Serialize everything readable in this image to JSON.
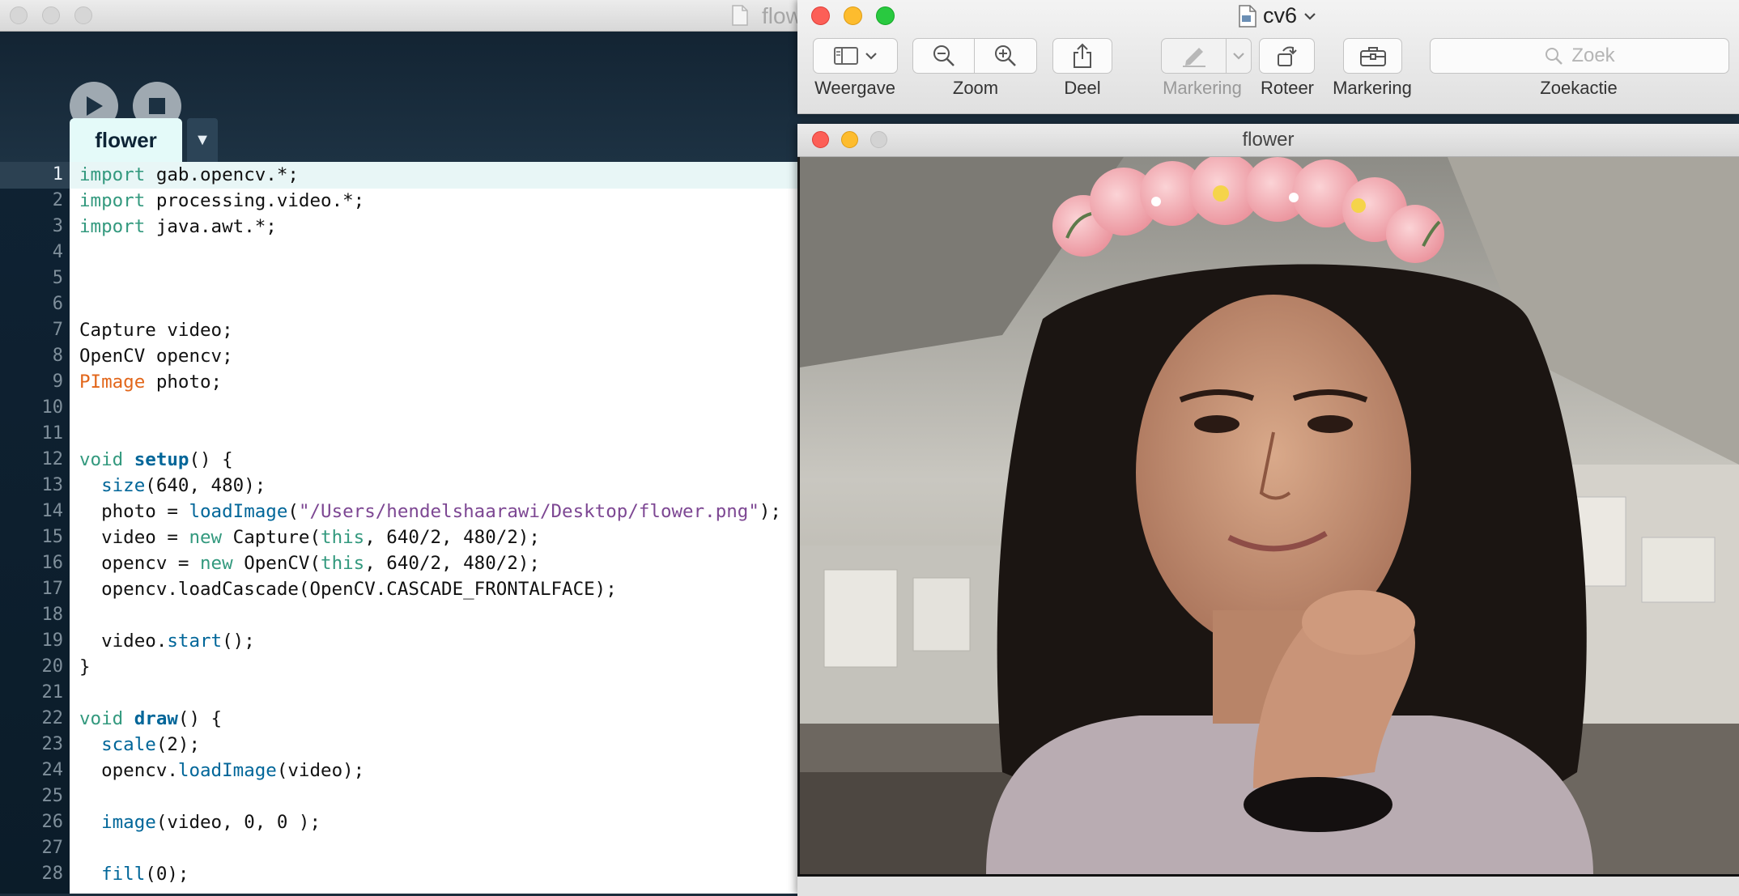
{
  "ide": {
    "window_title": "flow",
    "tab_label": "flower",
    "tab_menu_icon": "▼",
    "current_line": 1,
    "lines": [
      {
        "n": "1",
        "tokens": [
          {
            "t": "import",
            "c": "kw"
          },
          {
            "t": " gab.opencv.*;",
            "c": ""
          }
        ]
      },
      {
        "n": "2",
        "tokens": [
          {
            "t": "import",
            "c": "kw"
          },
          {
            "t": " processing.video.*;",
            "c": ""
          }
        ]
      },
      {
        "n": "3",
        "tokens": [
          {
            "t": "import",
            "c": "kw"
          },
          {
            "t": " java.awt.*;",
            "c": ""
          }
        ]
      },
      {
        "n": "4",
        "tokens": []
      },
      {
        "n": "5",
        "tokens": []
      },
      {
        "n": "6",
        "tokens": []
      },
      {
        "n": "7",
        "tokens": [
          {
            "t": "Capture video;",
            "c": ""
          }
        ]
      },
      {
        "n": "8",
        "tokens": [
          {
            "t": "OpenCV opencv;",
            "c": ""
          }
        ]
      },
      {
        "n": "9",
        "tokens": [
          {
            "t": "PImage",
            "c": "ty"
          },
          {
            "t": " photo;",
            "c": ""
          }
        ]
      },
      {
        "n": "10",
        "tokens": []
      },
      {
        "n": "11",
        "tokens": []
      },
      {
        "n": "12",
        "tokens": [
          {
            "t": "void",
            "c": "kw"
          },
          {
            "t": " ",
            "c": ""
          },
          {
            "t": "setup",
            "c": "fnb"
          },
          {
            "t": "() {",
            "c": ""
          }
        ]
      },
      {
        "n": "13",
        "tokens": [
          {
            "t": "  ",
            "c": ""
          },
          {
            "t": "size",
            "c": "fn"
          },
          {
            "t": "(640, 480);",
            "c": ""
          }
        ]
      },
      {
        "n": "14",
        "tokens": [
          {
            "t": "  photo = ",
            "c": ""
          },
          {
            "t": "loadImage",
            "c": "fn"
          },
          {
            "t": "(",
            "c": ""
          },
          {
            "t": "\"/Users/hendelshaarawi/Desktop/flower.png\"",
            "c": "st"
          },
          {
            "t": ");",
            "c": ""
          }
        ]
      },
      {
        "n": "15",
        "tokens": [
          {
            "t": "  video = ",
            "c": ""
          },
          {
            "t": "new",
            "c": "kw"
          },
          {
            "t": " Capture(",
            "c": ""
          },
          {
            "t": "this",
            "c": "kw"
          },
          {
            "t": ", 640/2, 480/2);",
            "c": ""
          }
        ]
      },
      {
        "n": "16",
        "tokens": [
          {
            "t": "  opencv = ",
            "c": ""
          },
          {
            "t": "new",
            "c": "kw"
          },
          {
            "t": " OpenCV(",
            "c": ""
          },
          {
            "t": "this",
            "c": "kw"
          },
          {
            "t": ", 640/2, 480/2);",
            "c": ""
          }
        ]
      },
      {
        "n": "17",
        "tokens": [
          {
            "t": "  opencv.loadCascade(OpenCV.CASCADE_FRONTALFACE);",
            "c": ""
          }
        ]
      },
      {
        "n": "18",
        "tokens": []
      },
      {
        "n": "19",
        "tokens": [
          {
            "t": "  video.",
            "c": ""
          },
          {
            "t": "start",
            "c": "fn"
          },
          {
            "t": "();",
            "c": ""
          }
        ]
      },
      {
        "n": "20",
        "tokens": [
          {
            "t": "}",
            "c": ""
          }
        ]
      },
      {
        "n": "21",
        "tokens": []
      },
      {
        "n": "22",
        "tokens": [
          {
            "t": "void",
            "c": "kw"
          },
          {
            "t": " ",
            "c": ""
          },
          {
            "t": "draw",
            "c": "fnb"
          },
          {
            "t": "() {",
            "c": ""
          }
        ]
      },
      {
        "n": "23",
        "tokens": [
          {
            "t": "  ",
            "c": ""
          },
          {
            "t": "scale",
            "c": "fn"
          },
          {
            "t": "(2);",
            "c": ""
          }
        ]
      },
      {
        "n": "24",
        "tokens": [
          {
            "t": "  opencv.",
            "c": ""
          },
          {
            "t": "loadImage",
            "c": "fn"
          },
          {
            "t": "(video);",
            "c": ""
          }
        ]
      },
      {
        "n": "25",
        "tokens": []
      },
      {
        "n": "26",
        "tokens": [
          {
            "t": "  ",
            "c": ""
          },
          {
            "t": "image",
            "c": "fn"
          },
          {
            "t": "(video, 0, 0 );",
            "c": ""
          }
        ]
      },
      {
        "n": "27",
        "tokens": []
      },
      {
        "n": "28",
        "tokens": [
          {
            "t": "  ",
            "c": ""
          },
          {
            "t": "fill",
            "c": "fn"
          },
          {
            "t": "(0);",
            "c": ""
          }
        ]
      }
    ]
  },
  "preview": {
    "title": "cv6",
    "toolbar": {
      "view_label": "Weergave",
      "zoom_label": "Zoom",
      "share_label": "Deel",
      "markup_disabled_label": "Markering",
      "rotate_label": "Roteer",
      "markup_label": "Markering",
      "search_label": "Zoekactie",
      "search_placeholder": "Zoek"
    }
  },
  "sketch": {
    "title": "flower"
  },
  "colors": {
    "keyword": "#33997e",
    "function": "#006699",
    "type": "#e2661a",
    "string": "#7d4793",
    "ide_background": "#1b2d3c"
  }
}
